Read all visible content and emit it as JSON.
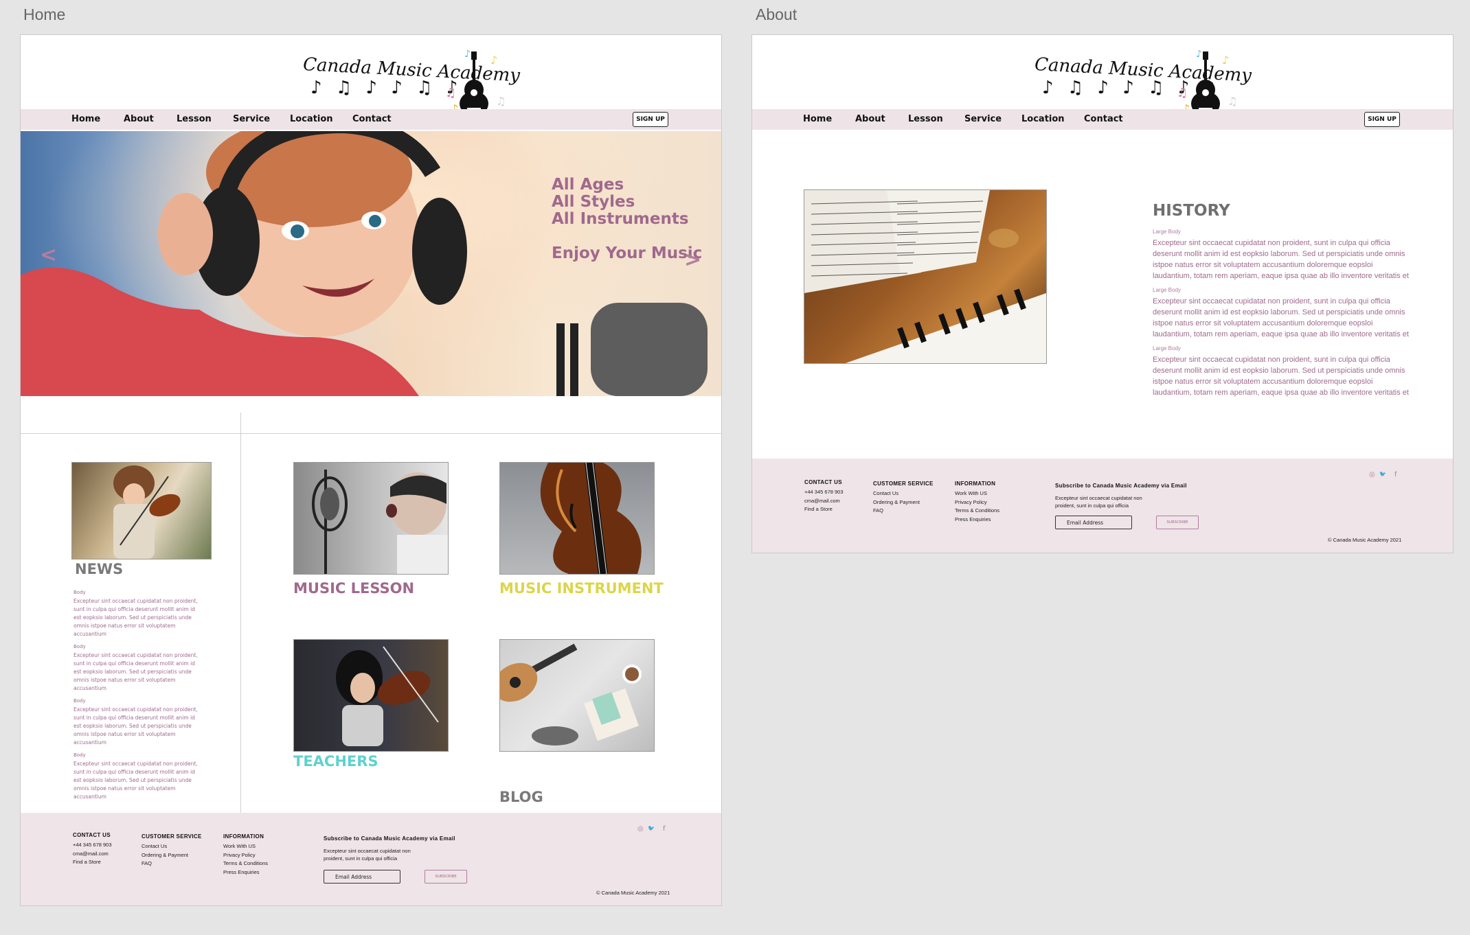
{
  "frames": {
    "home_label": "Home",
    "about_label": "About"
  },
  "logo": {
    "wordmark": "Canada Music Academy",
    "notes": "♪ ♫ ♪ ♪ ♫ ♪ ♪",
    "color_notes": "♪ ♫ ♪ ♫"
  },
  "nav": {
    "items": [
      "Home",
      "About",
      "Lesson",
      "Service",
      "Location",
      "Contact"
    ],
    "signup": "SIGN UP"
  },
  "hero": {
    "lines": [
      "All Ages",
      "All Styles",
      "All Instruments"
    ],
    "tagline": "Enjoy Your Music",
    "prev_arrow": "<",
    "next_arrow": ">"
  },
  "news": {
    "title": "NEWS",
    "items": [
      {
        "label": "Body",
        "text": "Excepteur sint occaecat cupidatat non proident, sunt in culpa qui officia deserunt mollit anim id est eopksio laborum. Sed ut perspiciatis unde omnis istpoe natus error sit voluptatem accusantium"
      },
      {
        "label": "Body",
        "text": "Excepteur sint occaecat cupidatat non proident, sunt in culpa qui officia deserunt mollit anim id est eopksio laborum. Sed ut perspiciatis unde omnis istpoe natus error sit voluptatem accusantium"
      },
      {
        "label": "Body",
        "text": "Excepteur sint occaecat cupidatat non proident, sunt in culpa qui officia deserunt mollit anim id est eopksio laborum. Sed ut perspiciatis unde omnis istpoe natus error sit voluptatem accusantium"
      },
      {
        "label": "Body",
        "text": "Excepteur sint occaecat cupidatat non proident, sunt in culpa qui officia deserunt mollit anim id est eopksio laborum. Sed ut perspiciatis unde omnis istpoe natus error sit voluptatem accusantium"
      }
    ]
  },
  "cards": {
    "music_lesson": "MUSIC LESSON",
    "music_instrument": "MUSIC INSTRUMENT",
    "teachers": "TEACHERS",
    "blog": "BLOG"
  },
  "history": {
    "title": "HISTORY",
    "paragraphs": [
      {
        "label": "Large Body",
        "text": "Excepteur sint occaecat cupidatat non proident, sunt in culpa qui officia deserunt mollit anim id est eopksio laborum. Sed ut perspiciatis unde omnis istpoe natus error sit voluptatem accusantium doloremque eopsloi laudantium, totam rem aperiam, eaque ipsa quae ab illo inventore veritatis et"
      },
      {
        "label": "Large Body",
        "text": "Excepteur sint occaecat cupidatat non proident, sunt in culpa qui officia deserunt mollit anim id est eopksio laborum. Sed ut perspiciatis unde omnis istpoe natus error sit voluptatem accusantium doloremque eopsloi laudantium, totam rem aperiam, eaque ipsa quae ab illo inventore veritatis et"
      },
      {
        "label": "Large Body",
        "text": "Excepteur sint occaecat cupidatat non proident, sunt in culpa qui officia deserunt mollit anim id est eopksio laborum. Sed ut perspiciatis unde omnis istpoe natus error sit voluptatem accusantium doloremque eopsloi laudantium, totam rem aperiam, eaque ipsa quae ab illo inventore veritatis et"
      }
    ]
  },
  "footer": {
    "contact": {
      "heading": "CONTACT US",
      "items": [
        "+44 345 678 903",
        "cma@mail.com",
        "Find a Store"
      ]
    },
    "customer_service": {
      "heading": "CUSTOMER SERVICE",
      "items": [
        "Contact Us",
        "Ordering & Payment",
        "FAQ"
      ]
    },
    "information": {
      "heading": "INFORMATION",
      "items": [
        "Work With US",
        "Privacy Policy",
        "Terms & Conditions",
        "Press Enquiries"
      ]
    },
    "subscribe_heading": "Subscribe to Canada Music Academy via Email",
    "subscribe_text": "Excepteur sint occaecat cupidatat non proident, sunt in culpa qui officia",
    "email_placeholder": "Email Address",
    "subscribe_button": "SUBSCRIBE",
    "social": {
      "instagram": "◎",
      "twitter": "🐦",
      "facebook": "f"
    },
    "copyright": "© Canada Music Academy 2021"
  },
  "colors": {
    "accent": "#a0698d",
    "nav_bg": "#eee3e7",
    "footer_bg": "#efe4e8",
    "instrument": "#dcd54a",
    "teachers": "#5ed2cf",
    "blog": "#7a7a7a"
  }
}
